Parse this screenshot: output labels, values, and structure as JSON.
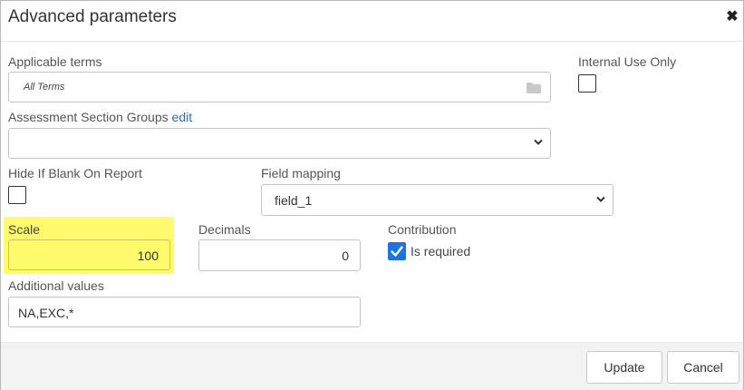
{
  "dialog": {
    "title": "Advanced parameters",
    "close_icon": "close-icon"
  },
  "applicable_terms": {
    "label": "Applicable terms",
    "value": "All Terms",
    "icon": "folder-icon"
  },
  "internal_use_only": {
    "label": "Internal Use Only",
    "checked": false
  },
  "assessment_section_groups": {
    "label": "Assessment Section Groups",
    "edit_link": "edit",
    "value": ""
  },
  "hide_if_blank": {
    "label": "Hide If Blank On Report",
    "checked": false
  },
  "field_mapping": {
    "label": "Field mapping",
    "value": "field_1"
  },
  "scale": {
    "label": "Scale",
    "value": "100",
    "highlight_color": "#fffb6a"
  },
  "decimals": {
    "label": "Decimals",
    "value": "0"
  },
  "contribution": {
    "label": "Contribution",
    "checkbox_label": "Is required",
    "checked": true,
    "accent_color": "#1a73e8"
  },
  "additional_values": {
    "label": "Additional values",
    "value": "NA,EXC,*"
  },
  "footer": {
    "update_label": "Update",
    "cancel_label": "Cancel"
  }
}
